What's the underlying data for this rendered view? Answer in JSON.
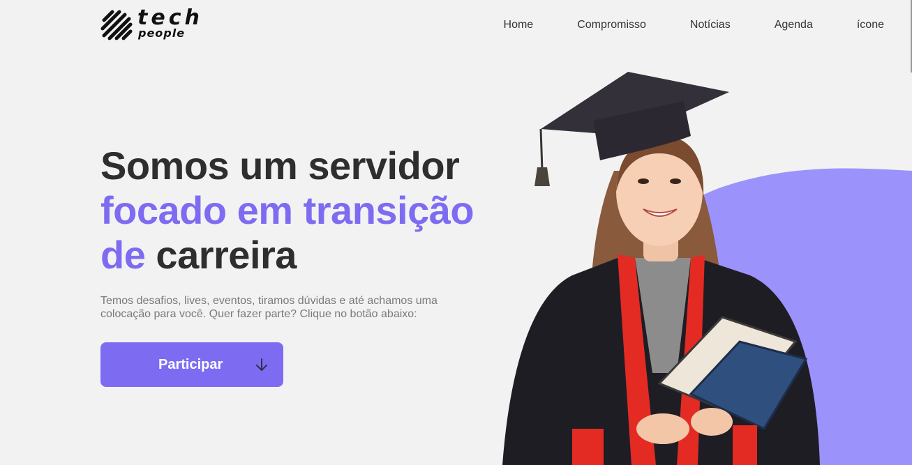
{
  "brand": {
    "logo_top": "tech",
    "logo_bottom": "people"
  },
  "nav": {
    "items": [
      "Home",
      "Compromisso",
      "Notícias",
      "Agenda",
      "ícone"
    ]
  },
  "hero": {
    "headline_line1": "Somos um servidor",
    "headline_line2_accent": "focado em transição",
    "headline_line3_accent": "de",
    "headline_line3_rest": "carreira",
    "subtitle": "Temos desafios, lives, eventos, tiramos dúvidas e até achamos uma colocação para você. Quer fazer parte? Clique no botão abaixo:",
    "cta_label": "Participar",
    "cta_icon": "arrow-down-icon"
  },
  "illustration": {
    "subject": "graduate-student-icon"
  },
  "colors": {
    "accent": "#7d6cf2",
    "background": "#f2f2f2",
    "text_dark": "#2e2e2e",
    "text_muted": "#7a7a7a",
    "blob": "#9b93fb"
  }
}
